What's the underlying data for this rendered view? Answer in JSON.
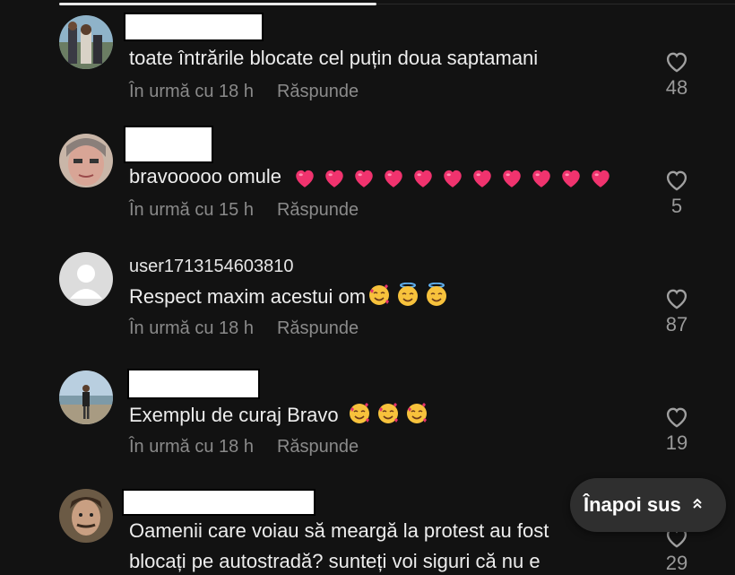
{
  "comments": [
    {
      "username": "",
      "text": "toate întrările blocate cel puțin doua saptamani",
      "time": "În urmă cu 18 h",
      "reply": "Răspunde",
      "likes": "48",
      "hearts": 0,
      "emoji_faces": []
    },
    {
      "username": "",
      "text": "bravooooo omule",
      "time": "În urmă cu 15 h",
      "reply": "Răspunde",
      "likes": "5",
      "hearts": 11,
      "emoji_faces": []
    },
    {
      "username": "user1713154603810",
      "text": "Respect maxim acestui om",
      "time": "În urmă cu 18 h",
      "reply": "Răspunde",
      "likes": "87",
      "hearts": 0,
      "emoji_faces": [
        "smiling-face-with-hearts",
        "smiling-face-with-halo",
        "smiling-face-with-halo"
      ]
    },
    {
      "username": "",
      "text": "Exemplu de curaj Bravo",
      "time": "În urmă cu 18 h",
      "reply": "Răspunde",
      "likes": "19",
      "hearts": 0,
      "emoji_faces": [
        "smiling-face-with-hearts",
        "smiling-face-with-hearts",
        "smiling-face-with-hearts"
      ]
    },
    {
      "username": "",
      "text_line1": "Oamenii care voiau să meargă la protest au fost",
      "text_line2": "blocați pe autostradă? sunteți voi siguri că nu e",
      "likes": "29"
    }
  ],
  "back_to_top": {
    "label": "Înapoi sus",
    "icon": "double-chevron-up-icon"
  },
  "icons": {
    "like": "heart-outline-icon"
  }
}
